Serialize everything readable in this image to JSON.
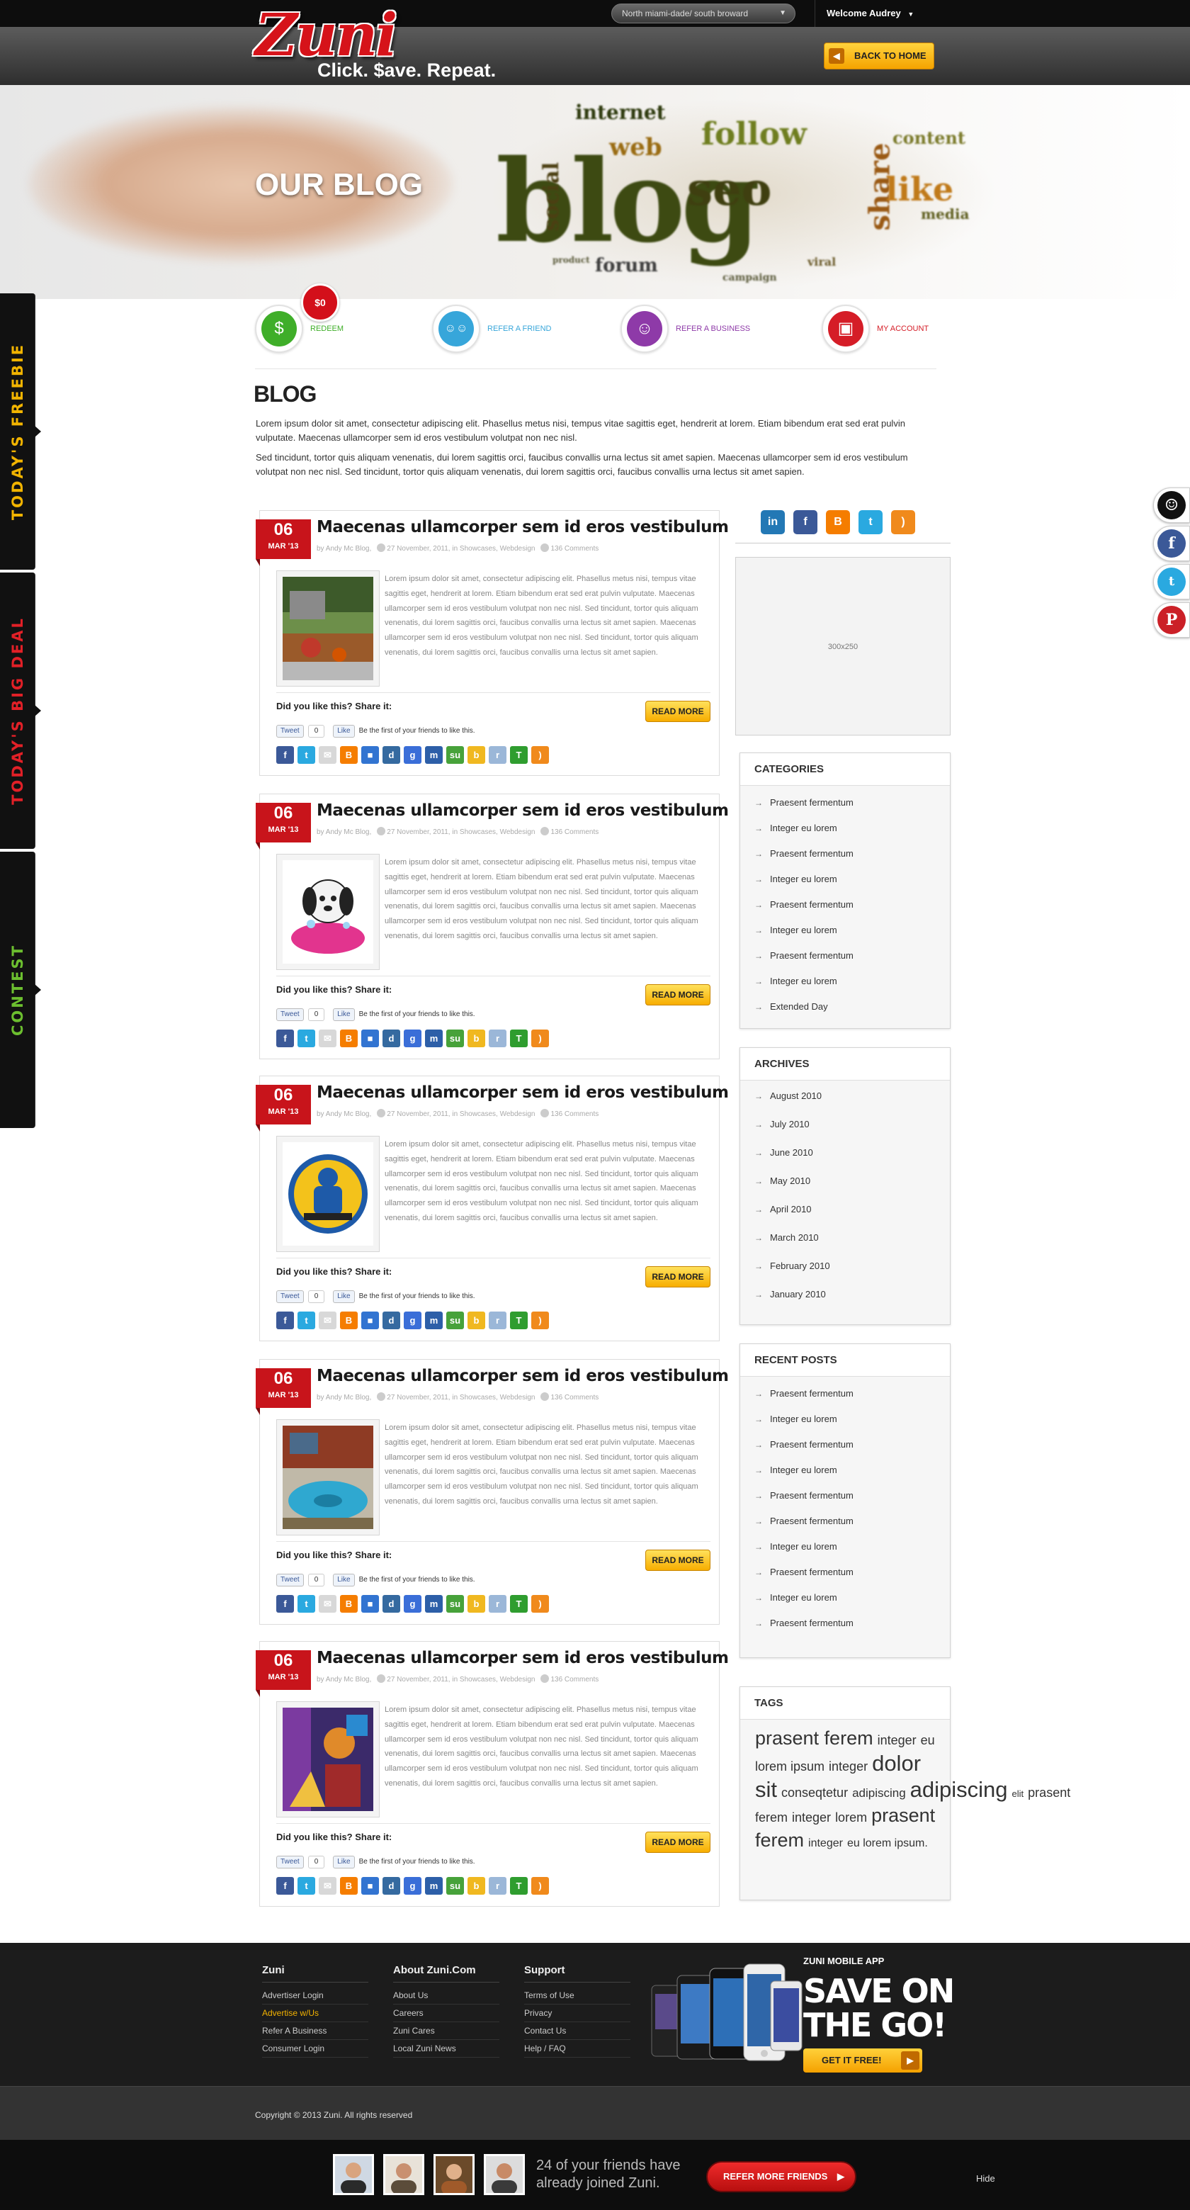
{
  "header": {
    "logo_word": "Zuni",
    "logo_tagline": "Click. $ave. Repeat.",
    "location": "North miami-dade/ south broward",
    "welcome": "Welcome Audrey",
    "back_home": "BACK TO HOME"
  },
  "banner": {
    "title": "OUR BLOG",
    "words": [
      "internet",
      "social",
      "web",
      "seo",
      "blog",
      "follow",
      "share",
      "like",
      "forum",
      "content",
      "media",
      "campaign",
      "product",
      "viral",
      "content"
    ]
  },
  "side_tabs": [
    "TODAY'S FREEBIE",
    "TODAY'S BIG DEAL",
    "CONTEST"
  ],
  "quick_links": [
    {
      "label": "REDEEM",
      "color": "#3fae29",
      "icon": "$"
    },
    {
      "label": "REFER A FRIEND",
      "color": "#37a6da",
      "icon": "☺☺"
    },
    {
      "label": "REFER A BUSINESS",
      "color": "#8e3aa8",
      "icon": "☺"
    },
    {
      "label": "MY ACCOUNT",
      "color": "#d51d27",
      "icon": "▣"
    }
  ],
  "redeem_badge": "$0",
  "intro": {
    "title": "BLOG",
    "p1": "Lorem ipsum dolor sit amet, consectetur adipiscing elit. Phasellus metus nisi, tempus vitae sagittis eget, hendrerit at lorem. Etiam bibendum erat sed erat pulvin vulputate. Maecenas ullamcorper sem id eros vestibulum volutpat non nec nisl.",
    "p2": "Sed tincidunt, tortor quis aliquam venenatis, dui lorem sagittis orci, faucibus convallis urna lectus sit amet sapien.  Maecenas ullamcorper sem id eros vestibulum volutpat non nec nisl. Sed tincidunt, tortor quis aliquam venenatis, dui lorem sagittis orci, faucibus convallis urna lectus sit amet sapien."
  },
  "post_common": {
    "day": "06",
    "month": "MAR '13",
    "title": "Maecenas ullamcorper sem id eros vestibulum",
    "author": "by Andy Mc Blog,",
    "date": "27 November, 2011, in Showcases, Webdesign",
    "comments": "136 Comments",
    "body": "Lorem ipsum dolor sit amet, consectetur adipiscing elit. Phasellus metus nisi, tempus vitae sagittis eget, hendrerit at lorem. Etiam bibendum erat sed erat pulvin vulputate. Maecenas ullamcorper sem id eros vestibulum volutpat non nec nisl. Sed tincidunt, tortor quis aliquam venenatis, dui lorem sagittis orci, faucibus convallis urna lectus sit amet sapien.  Maecenas ullamcorper sem id eros vestibulum volutpat non nec nisl. Sed tincidunt, tortor quis aliquam venenatis, dui lorem sagittis orci, faucibus convallis urna lectus sit amet sapien.",
    "share_q": "Did you like this? Share it:",
    "read_more": "READ MORE",
    "tweet": "Tweet",
    "tweet_count": "0",
    "like": "Like",
    "like_text": "Be the first of your friends to like this."
  },
  "share_icons": [
    {
      "name": "facebook",
      "color": "#3b5998",
      "g": "f"
    },
    {
      "name": "twitter",
      "color": "#2aa9e0",
      "g": "t"
    },
    {
      "name": "email",
      "color": "#d8d8d8",
      "g": "✉"
    },
    {
      "name": "blogger",
      "color": "#f57d00",
      "g": "B"
    },
    {
      "name": "delicious",
      "color": "#3274d1",
      "g": "■"
    },
    {
      "name": "digg",
      "color": "#356aa0",
      "g": "d"
    },
    {
      "name": "google",
      "color": "#3a6ed8",
      "g": "g"
    },
    {
      "name": "myspace",
      "color": "#2d5fa8",
      "g": "m"
    },
    {
      "name": "stumbleupon",
      "color": "#47a23a",
      "g": "su"
    },
    {
      "name": "buzz",
      "color": "#f0b820",
      "g": "b"
    },
    {
      "name": "reddit",
      "color": "#9bb7d8",
      "g": "r"
    },
    {
      "name": "technorati",
      "color": "#2f9d2f",
      "g": "T"
    },
    {
      "name": "rss",
      "color": "#f08a1c",
      "g": ")"
    }
  ],
  "posts": [
    {
      "thumb": "garden"
    },
    {
      "thumb": "dog"
    },
    {
      "thumb": "plumber"
    },
    {
      "thumb": "pool"
    },
    {
      "thumb": "art"
    }
  ],
  "sidebar": {
    "social": [
      {
        "name": "linkedin",
        "color": "#2378b5",
        "g": "in"
      },
      {
        "name": "facebook",
        "color": "#3b5998",
        "g": "f"
      },
      {
        "name": "blogger",
        "color": "#f57d00",
        "g": "B"
      },
      {
        "name": "twitter",
        "color": "#2aa9e0",
        "g": "t"
      },
      {
        "name": "rss",
        "color": "#f08a1c",
        "g": ")"
      }
    ],
    "ad": "300x250",
    "categories": {
      "title": "CATEGORIES",
      "items": [
        "Praesent fermentum",
        "Integer eu lorem",
        "Praesent fermentum",
        "Integer eu lorem",
        "Praesent fermentum",
        "Integer eu lorem",
        "Praesent fermentum",
        "Integer eu lorem",
        "Extended Day"
      ]
    },
    "archives": {
      "title": "ARCHIVES",
      "items": [
        "August 2010",
        "July 2010",
        "June 2010",
        "May 2010",
        "April 2010",
        "March 2010",
        "February 2010",
        "January 2010"
      ]
    },
    "recent": {
      "title": "RECENT POSTS",
      "items": [
        "Praesent fermentum",
        "Integer eu lorem",
        "Praesent fermentum",
        "Integer eu lorem",
        "Praesent fermentum",
        "Praesent fermentum",
        "Integer eu lorem",
        "Praesent fermentum",
        "Integer eu lorem",
        "Praesent fermentum"
      ]
    },
    "tags": {
      "title": "TAGS",
      "items": [
        {
          "t": "prasent ferem",
          "s": 27
        },
        {
          "t": "integer",
          "s": 18
        },
        {
          "t": "eu lorem ipsum",
          "s": 18
        },
        {
          "t": "integer",
          "s": 18
        },
        {
          "t": "dolor sit",
          "s": 31
        },
        {
          "t": "conseqtetur",
          "s": 18
        },
        {
          "t": "adipiscing",
          "s": 17
        },
        {
          "t": "adipiscing",
          "s": 31
        },
        {
          "t": "elit",
          "s": 13
        },
        {
          "t": "prasent ferem",
          "s": 18
        },
        {
          "t": "integer",
          "s": 18
        },
        {
          "t": "lorem",
          "s": 18
        },
        {
          "t": "prasent ferem",
          "s": 27
        },
        {
          "t": "integer",
          "s": 16
        },
        {
          "t": "eu lorem ipsum.",
          "s": 16
        }
      ]
    }
  },
  "footer": {
    "cols": [
      {
        "h": "Zuni",
        "links": [
          "Advertiser Login",
          "Advertise w/Us",
          "Refer A Business",
          "Consumer Login"
        ]
      },
      {
        "h": "About Zuni.Com",
        "links": [
          "About Us",
          "Careers",
          "Zuni Cares",
          "Local Zuni News"
        ]
      },
      {
        "h": "Support",
        "links": [
          "Terms of Use",
          "Privacy",
          "Contact Us",
          "Help / FAQ"
        ]
      }
    ],
    "highlight_color": "#f3b200",
    "mobile_label": "ZUNI MOBILE APP",
    "mobile_big1": "SAVE ON",
    "mobile_big2": "THE GO!",
    "get_it": "GET IT FREE!",
    "copyright": "Copyright © 2013 Zuni. All rights reserved"
  },
  "bottombar": {
    "text1": "24 of your friends have",
    "text2": "already joined Zuni.",
    "refer_btn": "REFER MORE FRIENDS",
    "hide": "Hide"
  }
}
